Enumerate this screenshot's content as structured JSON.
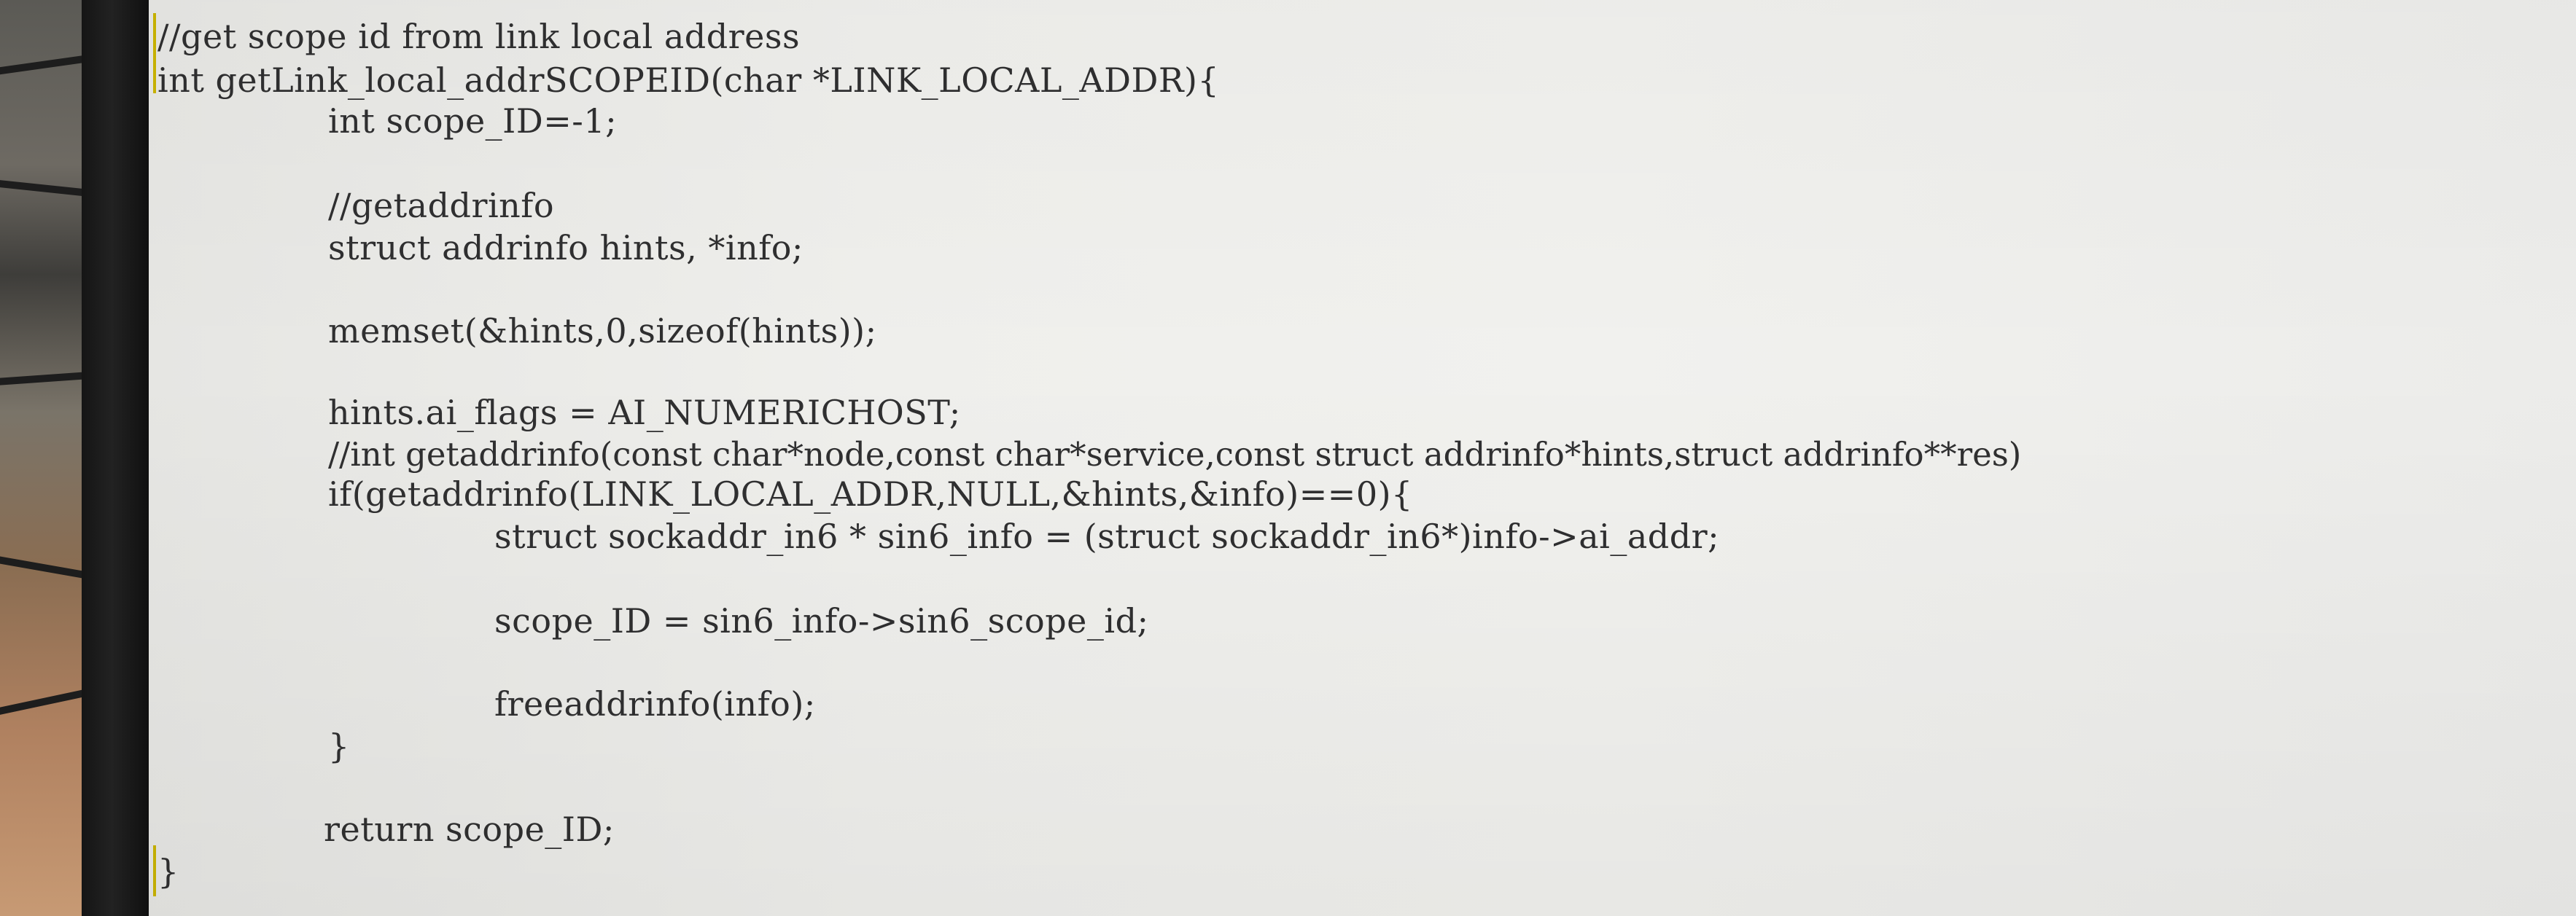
{
  "code": {
    "lines": [
      "//get scope id from link local address",
      "int getLink_local_addrSCOPEID(char *LINK_LOCAL_ADDR){",
      "int scope_ID=-1;",
      "//getaddrinfo",
      "struct addrinfo hints, *info;",
      "memset(&hints,0,sizeof(hints));",
      "hints.ai_flags = AI_NUMERICHOST;",
      "//int getaddrinfo(const char*node,const char*service,const struct addrinfo*hints,struct addrinfo**res)",
      "if(getaddrinfo(LINK_LOCAL_ADDR,NULL,&hints,&info)==0){",
      "struct sockaddr_in6 * sin6_info = (struct sockaddr_in6*)info->ai_addr;",
      "scope_ID = sin6_info->sin6_scope_id;",
      "freeaddrinfo(info);",
      "}",
      "return scope_ID;",
      "}"
    ]
  }
}
